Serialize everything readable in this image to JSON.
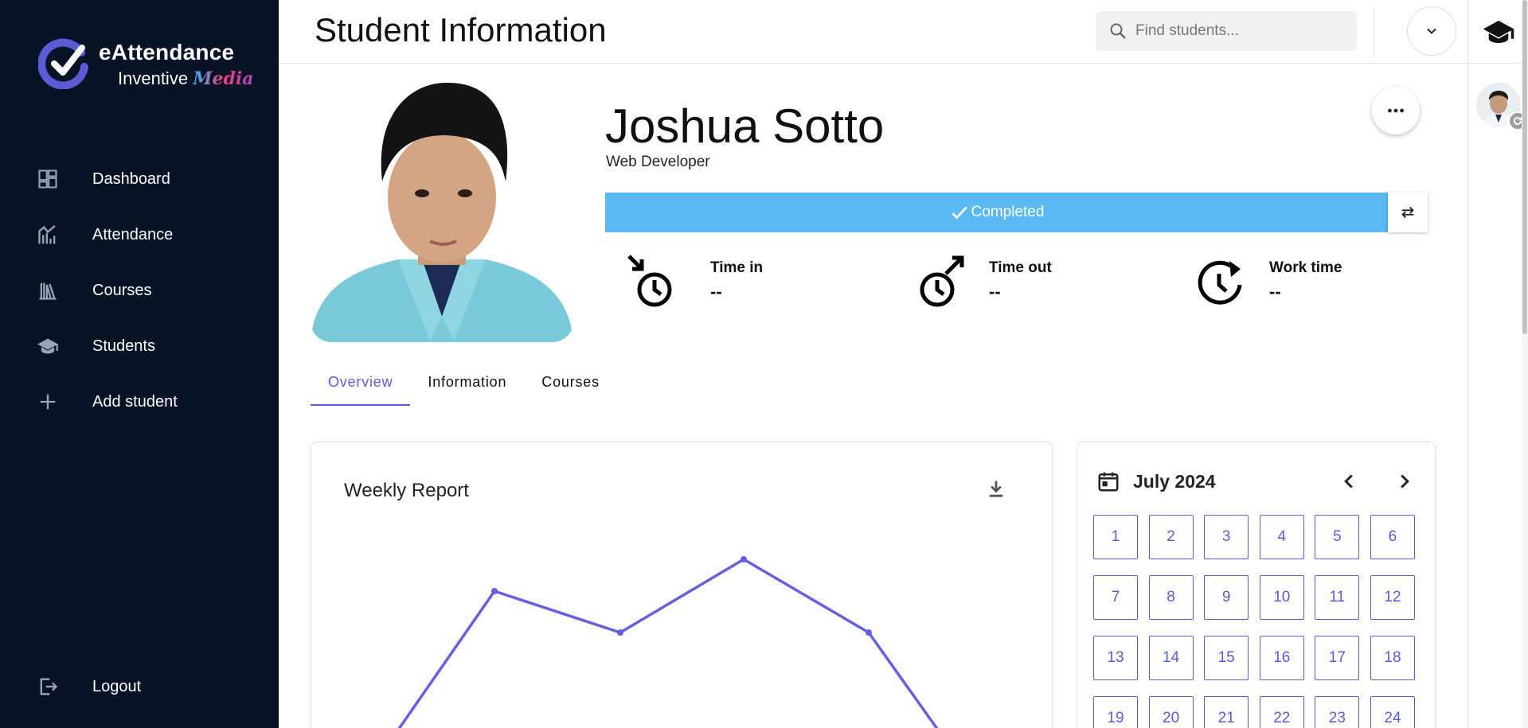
{
  "brand": {
    "title": "eAttendance",
    "sub_prefix": "Inventive",
    "sub_media": "Media"
  },
  "sidebar": {
    "items": [
      {
        "label": "Dashboard",
        "icon": "dashboard-icon"
      },
      {
        "label": "Attendance",
        "icon": "attendance-chart-icon"
      },
      {
        "label": "Courses",
        "icon": "books-icon"
      },
      {
        "label": "Students",
        "icon": "graduation-cap-icon"
      },
      {
        "label": "Add student",
        "icon": "plus-icon"
      }
    ],
    "logout": "Logout"
  },
  "header": {
    "title": "Student Information",
    "search_placeholder": "Find students..."
  },
  "profile": {
    "name": "Joshua Sotto",
    "role": "Web Developer",
    "status": "Completed",
    "status_color": "#5ab8f2",
    "stats": [
      {
        "label": "Time in",
        "value": "--"
      },
      {
        "label": "Time out",
        "value": "--"
      },
      {
        "label": "Work time",
        "value": "--"
      }
    ]
  },
  "tabs": [
    "Overview",
    "Information",
    "Courses"
  ],
  "report": {
    "title": "Weekly Report",
    "line_color": "#6660e0"
  },
  "calendar": {
    "month": "July 2024",
    "days": [
      "1",
      "2",
      "3",
      "4",
      "5",
      "6",
      "7",
      "8",
      "9",
      "10",
      "11",
      "12",
      "13",
      "14",
      "15",
      "16",
      "17",
      "18",
      "19",
      "20",
      "21",
      "22",
      "23",
      "24"
    ]
  },
  "accent": "#5b5bd6"
}
